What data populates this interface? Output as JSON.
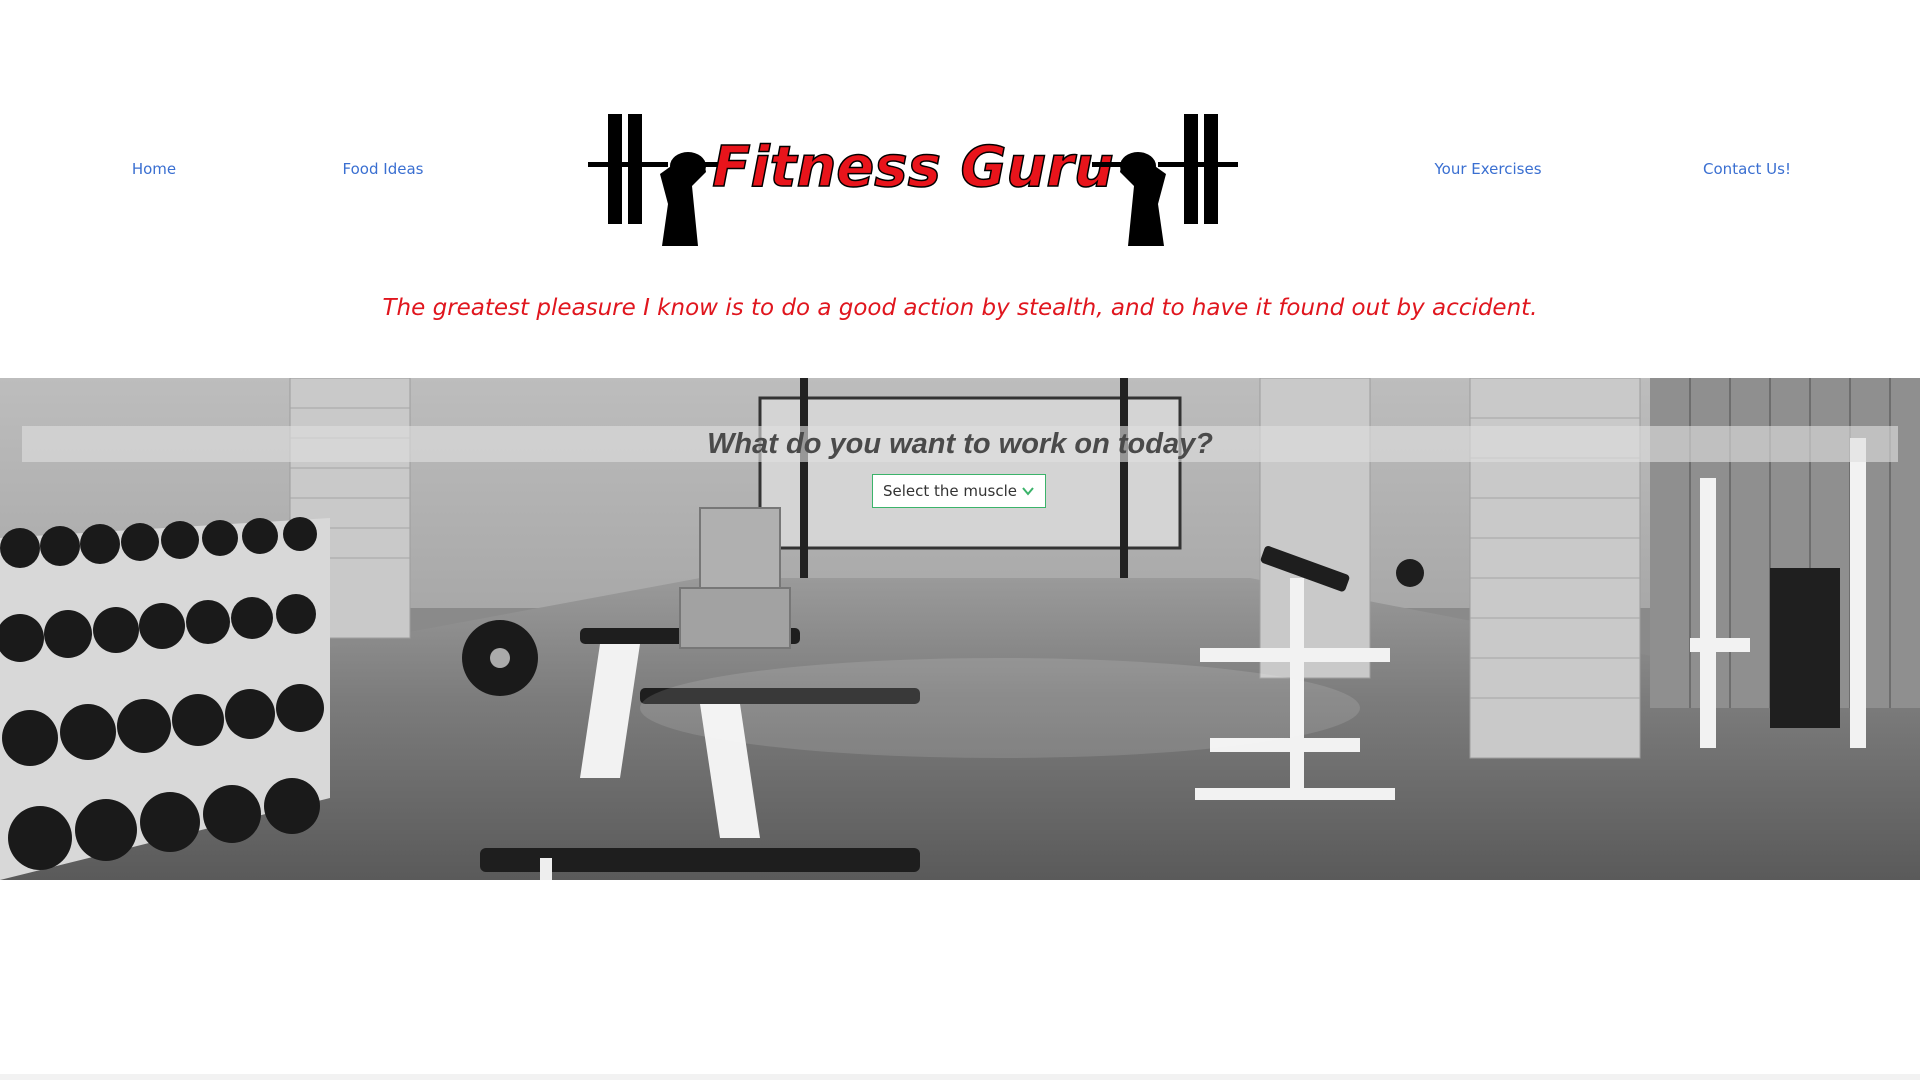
{
  "nav": {
    "home": "Home",
    "food_ideas": "Food Ideas",
    "your_exercises": "Your Exercises",
    "contact_us": "Contact Us!"
  },
  "logo": {
    "text": "Fitness Guru"
  },
  "quote": "The greatest pleasure I know is to do a good action by stealth, and to have it found out by accident.",
  "hero": {
    "heading": "What do you want to work on today?",
    "select": {
      "selected": "Select the muscle"
    }
  },
  "colors": {
    "nav_link": "#3a6fd1",
    "quote": "#e0161e",
    "logo_text": "#e8141b",
    "select_border": "#3bb36a",
    "hero_heading": "#4a4a4a"
  },
  "icons": {
    "logo_left": "barbell-fist-icon",
    "logo_right": "barbell-fist-icon",
    "select_caret": "chevron-down-icon"
  }
}
